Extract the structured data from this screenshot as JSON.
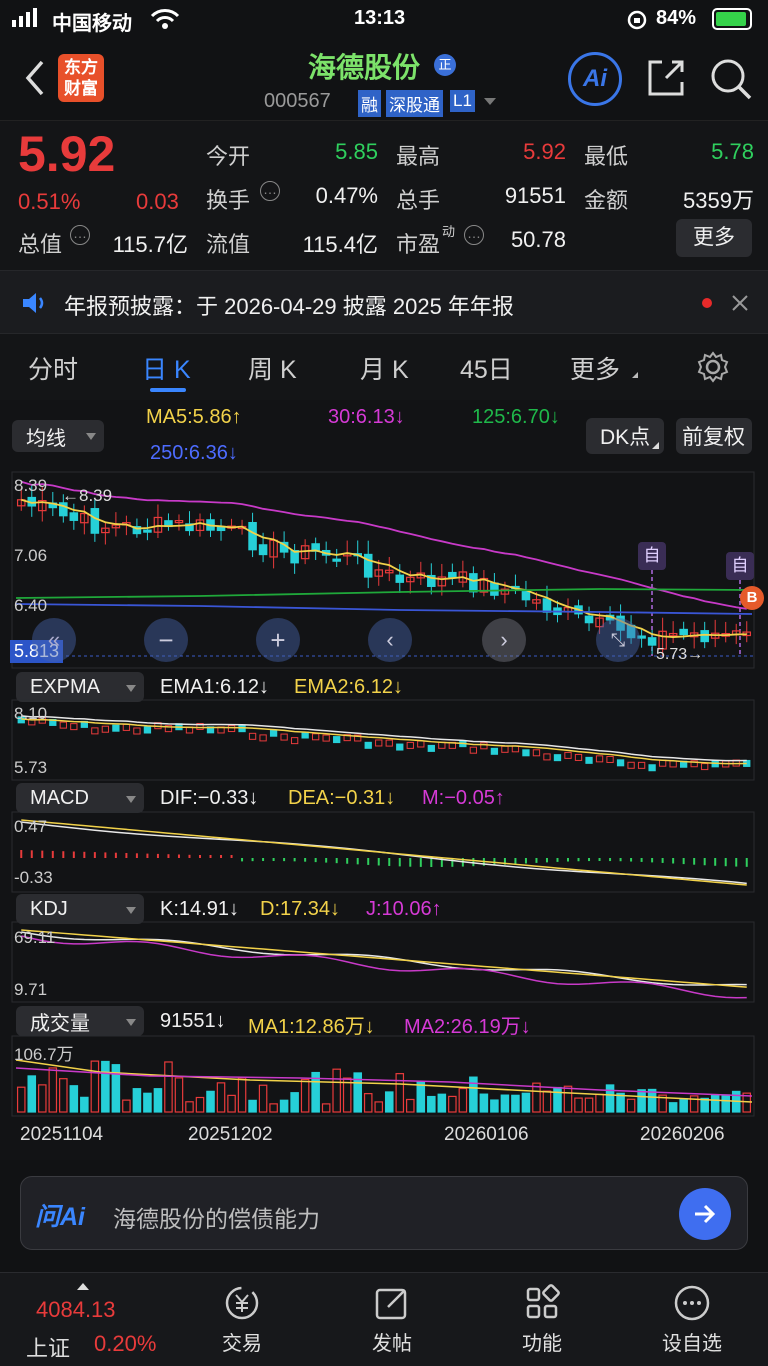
{
  "status_bar": {
    "carrier": "中国移动",
    "time": "13:13",
    "battery": "84%"
  },
  "header": {
    "logo_line1": "东方",
    "logo_line2": "财富",
    "stock_name": "海德股份",
    "badge": "正",
    "code": "000567",
    "tag_rong": "融",
    "tag_sgt": "深股通",
    "tag_level": "L1",
    "ai_label": "Ai"
  },
  "quote": {
    "price": "5.92",
    "change_pct": "0.51%",
    "change_amt": "0.03",
    "open_label": "今开",
    "open": "5.85",
    "high_label": "最高",
    "high": "5.92",
    "low_label": "最低",
    "low": "5.78",
    "turnover_label": "换手",
    "turnover": "0.47%",
    "volume_label": "总手",
    "volume": "91551",
    "amount_label": "金额",
    "amount": "5359万",
    "mktcap_label": "总值",
    "mktcap": "115.7亿",
    "float_label": "流值",
    "float_cap": "115.4亿",
    "pe_label": "市盈",
    "pe_sup": "动",
    "pe": "50.78",
    "more_button": "更多"
  },
  "notice": {
    "text": "年报预披露：于 2026-04-29 披露 2025 年年报"
  },
  "tabs": [
    {
      "label": "分时",
      "active": false
    },
    {
      "label": "日 K",
      "active": true
    },
    {
      "label": "周 K",
      "active": false
    },
    {
      "label": "月 K",
      "active": false
    },
    {
      "label": "45日",
      "active": false
    },
    {
      "label": "更多",
      "active": false
    }
  ],
  "indicators": {
    "ma_selector": "均线",
    "ma5": "MA5:5.86↑",
    "ma30": "30:6.13↓",
    "ma125": "125:6.70↓",
    "ma250": "250:6.36↓",
    "dk_button": "DK点",
    "fq_button": "前复权",
    "expma_selector": "EXPMA",
    "ema1": "EMA1:6.12↓",
    "ema2": "EMA2:6.12↓",
    "macd_selector": "MACD",
    "dif": "DIF:−0.33↓",
    "dea": "DEA:−0.31↓",
    "m": "M:−0.05↑",
    "kdj_selector": "KDJ",
    "k": "K:14.91↓",
    "d": "D:17.34↓",
    "j": "J:10.06↑",
    "vol_selector": "成交量",
    "vol": "91551↓",
    "vma1": "MA1:12.86万↓",
    "vma2": "MA2:26.19万↓"
  },
  "chart_labels": {
    "main_top": "8.39",
    "main_max_marker": "8.39",
    "main_mid1": "7.06",
    "main_mid2": "6.40",
    "main_current": "5.813",
    "main_min_marker": "5.73",
    "marker_zi": "自",
    "marker_b": "B",
    "expma_top": "8.10",
    "expma_bottom": "5.73",
    "macd_top": "0.47",
    "macd_bottom": "-0.33",
    "kdj_top": "69.11",
    "kdj_bottom": "9.71",
    "vol_top": "106.7万",
    "dates": [
      "20251104",
      "20251202",
      "20260106",
      "20260206"
    ]
  },
  "colors": {
    "up": "#e83b3b",
    "down": "#26d0d8",
    "ma5": "#f2d24a",
    "ma30": "#c83ac8",
    "ma125": "#1fa83a",
    "ma250": "#3a56d6"
  },
  "ask": {
    "brand": "问Ai",
    "placeholder": "海德股份的偿债能力"
  },
  "bottom_nav": {
    "index_value": "4084.13",
    "index_name": "上证",
    "index_change": "0.20%",
    "items": [
      "交易",
      "发帖",
      "功能",
      "设自选"
    ]
  }
}
